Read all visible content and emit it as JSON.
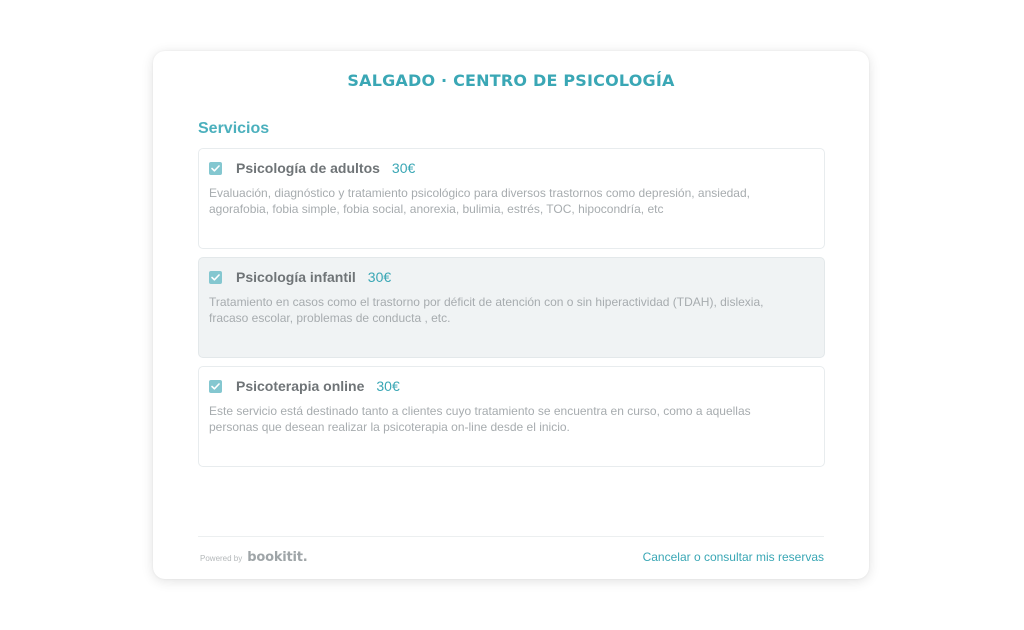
{
  "header": {
    "title": "SALGADO · CENTRO DE PSICOLOGÍA"
  },
  "services_section": {
    "title": "Servicios",
    "items": [
      {
        "name": "Psicología de adultos",
        "price": "30€",
        "description": "Evaluación, diagnóstico y tratamiento psicológico para diversos trastornos como depresión, ansiedad, agorafobia, fobia simple, fobia social, anorexia, bulimia, estrés, TOC, hipocondría, etc",
        "checked": true
      },
      {
        "name": "Psicología infantil",
        "price": "30€",
        "description": "Tratamiento en casos como el trastorno por déficit de atención con o sin hiperactividad (TDAH), dislexia, fracaso escolar, problemas de conducta , etc.",
        "checked": true
      },
      {
        "name": "Psicoterapia online",
        "price": "30€",
        "description": "Este servicio está destinado tanto a clientes cuyo tratamiento se encuentra en curso, como a aquellas personas que desean realizar la psicoterapia on-line desde el inicio.",
        "checked": true
      }
    ]
  },
  "footer": {
    "powered_label": "Powered by",
    "logo_text": "bookitit.",
    "cancel_link": "Cancelar o consultar mis reservas"
  },
  "colors": {
    "accent": "#3aa7b5",
    "checkbox": "#84c7d0",
    "selected_bg": "#f0f3f4"
  }
}
